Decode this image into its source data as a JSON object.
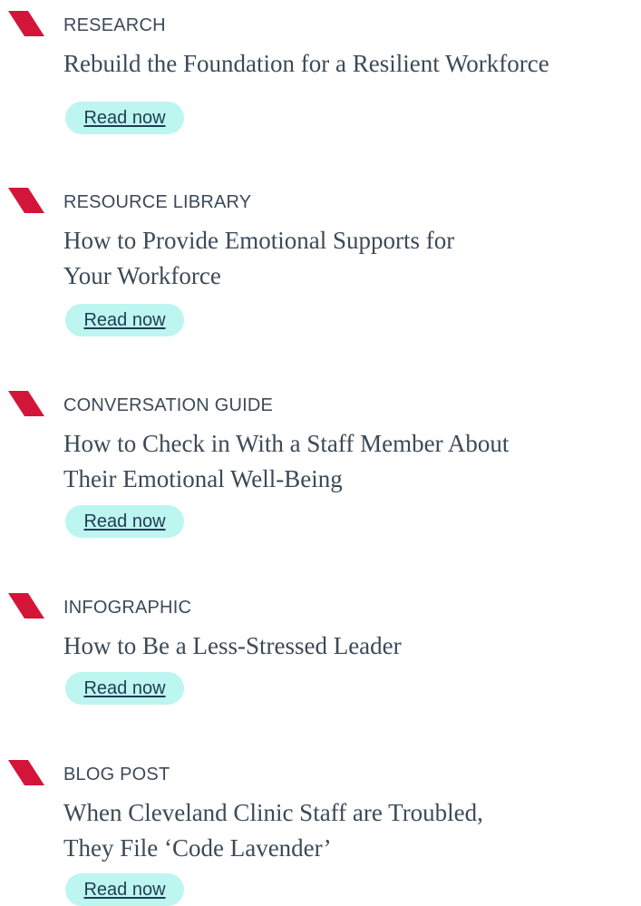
{
  "items": [
    {
      "category": "RESEARCH",
      "title_lines": [
        "Rebuild the Foundation for a Resilient Workforce"
      ],
      "cta": "Read now"
    },
    {
      "category": "RESOURCE LIBRARY",
      "title_lines": [
        "How to Provide Emotional Supports for",
        "Your Workforce"
      ],
      "cta": "Read now"
    },
    {
      "category": "CONVERSATION GUIDE",
      "title_lines": [
        "How to Check in With a Staff Member About",
        "Their Emotional Well-Being"
      ],
      "cta": "Read now"
    },
    {
      "category": "INFOGRAPHIC",
      "title_lines": [
        "How to Be a Less-Stressed Leader"
      ],
      "cta": "Read now"
    },
    {
      "category": "BLOG POST",
      "title_lines": [
        "When Cleveland Clinic Staff are Troubled,",
        "They File ‘Code Lavender’"
      ],
      "cta": "Read now"
    }
  ],
  "colors": {
    "accent": "#d4153a",
    "button_bg": "#bdf5f1",
    "text": "#3c4a57",
    "link": "#1f3d52"
  },
  "icons": {
    "marker": "red-slash-marker-icon"
  }
}
